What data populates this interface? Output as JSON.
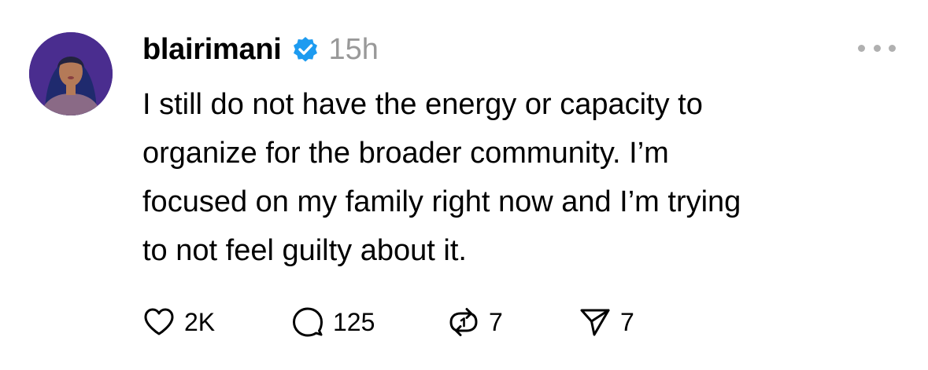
{
  "post": {
    "author": {
      "username": "blairimani",
      "verified": true,
      "verified_icon": "verified-badge-icon",
      "verified_color": "#1d9bf0",
      "avatar_icon": "avatar-photo"
    },
    "timestamp": "15h",
    "more_icon": "more-dots-icon",
    "text": "I still do not have the energy or capacity to\norganize for the broader community. I’m\nfocused on my family right now and I’m trying\nto not feel guilty about it.",
    "actions": {
      "like": {
        "icon": "heart-icon",
        "count": "2K"
      },
      "reply": {
        "icon": "comment-bubble-icon",
        "count": "125"
      },
      "repost": {
        "icon": "repost-icon",
        "count": "7"
      },
      "share": {
        "icon": "send-icon",
        "count": "7"
      }
    }
  },
  "colors": {
    "text": "#000000",
    "muted": "#999999",
    "background": "#ffffff"
  }
}
